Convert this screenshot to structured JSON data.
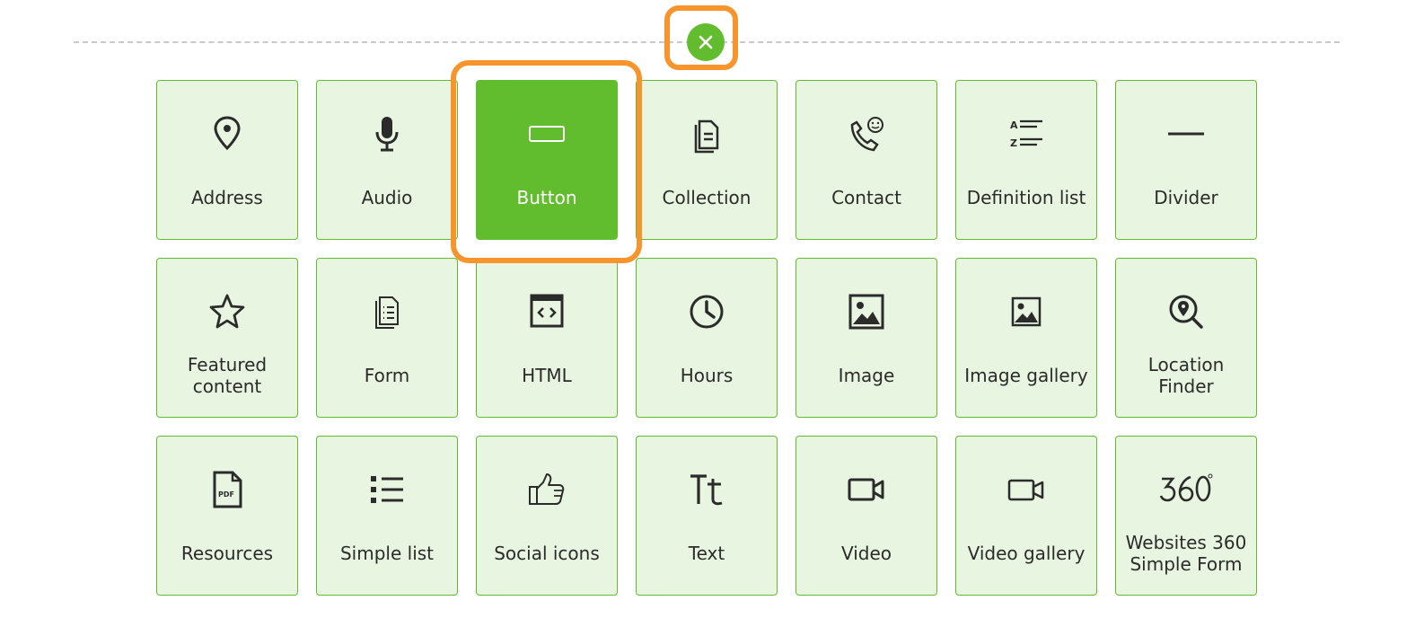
{
  "colors": {
    "accent": "#62bd2e",
    "tile_bg": "#e8f5e0",
    "highlight": "#f7942b",
    "text": "#2b2b2b"
  },
  "close": {
    "icon": "close-icon"
  },
  "tiles": [
    {
      "label": "Address",
      "icon": "location-pin-icon"
    },
    {
      "label": "Audio",
      "icon": "microphone-icon"
    },
    {
      "label": "Button",
      "icon": "button-icon",
      "selected": true
    },
    {
      "label": "Collection",
      "icon": "collection-icon"
    },
    {
      "label": "Contact",
      "icon": "contact-phone-icon"
    },
    {
      "label": "Definition list",
      "icon": "definition-list-icon"
    },
    {
      "label": "Divider",
      "icon": "divider-icon"
    },
    {
      "label": "Featured content",
      "icon": "star-icon"
    },
    {
      "label": "Form",
      "icon": "form-icon"
    },
    {
      "label": "HTML",
      "icon": "html-code-icon"
    },
    {
      "label": "Hours",
      "icon": "clock-icon"
    },
    {
      "label": "Image",
      "icon": "image-icon"
    },
    {
      "label": "Image gallery",
      "icon": "image-gallery-icon"
    },
    {
      "label": "Location Finder",
      "icon": "location-finder-icon"
    },
    {
      "label": "Resources",
      "icon": "pdf-file-icon"
    },
    {
      "label": "Simple list",
      "icon": "bullet-list-icon"
    },
    {
      "label": "Social icons",
      "icon": "thumbs-up-icon"
    },
    {
      "label": "Text",
      "icon": "text-icon"
    },
    {
      "label": "Video",
      "icon": "video-camera-icon"
    },
    {
      "label": "Video gallery",
      "icon": "video-gallery-icon"
    },
    {
      "label": "Websites 360 Simple Form",
      "icon": "websites-360-icon"
    }
  ]
}
